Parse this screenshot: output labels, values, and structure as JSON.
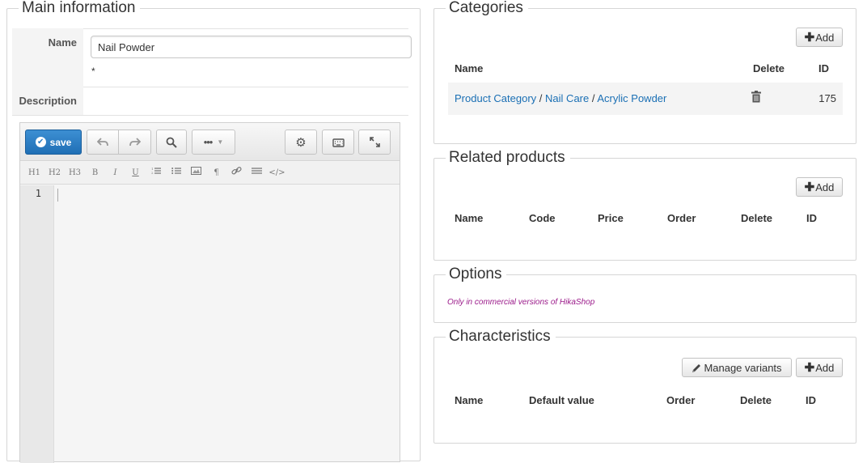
{
  "main": {
    "legend": "Main information",
    "name_label": "Name",
    "name_value": "Nail Powder",
    "required_mark": "*",
    "description_label": "Description",
    "editor": {
      "save_label": "save",
      "format_buttons": [
        "H1",
        "H2",
        "H3",
        "B",
        "I",
        "U",
        "ordered-list",
        "unordered-list",
        "image",
        "paragraph",
        "link",
        "horizontal-rule",
        "code"
      ],
      "format_labels": [
        "H1",
        "H2",
        "H3",
        "B",
        "I",
        "U"
      ],
      "line_number": "1"
    }
  },
  "categories": {
    "legend": "Categories",
    "add_label": "Add",
    "headers": {
      "name": "Name",
      "delete": "Delete",
      "id": "ID"
    },
    "row": {
      "path": [
        "Product Category",
        "Nail Care",
        "Acrylic Powder"
      ],
      "separator": "/",
      "id": "175"
    }
  },
  "related": {
    "legend": "Related products",
    "add_label": "Add",
    "headers": {
      "name": "Name",
      "code": "Code",
      "price": "Price",
      "order": "Order",
      "delete": "Delete",
      "id": "ID"
    }
  },
  "options": {
    "legend": "Options",
    "note": "Only in commercial versions of HikaShop",
    "note_color": "#9b1a8a"
  },
  "characteristics": {
    "legend": "Characteristics",
    "manage_label": "Manage variants",
    "add_label": "Add",
    "headers": {
      "name": "Name",
      "default_value": "Default value",
      "order": "Order",
      "delete": "Delete",
      "id": "ID"
    }
  },
  "colors": {
    "accent": "#1f6fb5",
    "link": "#1a6fb4"
  }
}
